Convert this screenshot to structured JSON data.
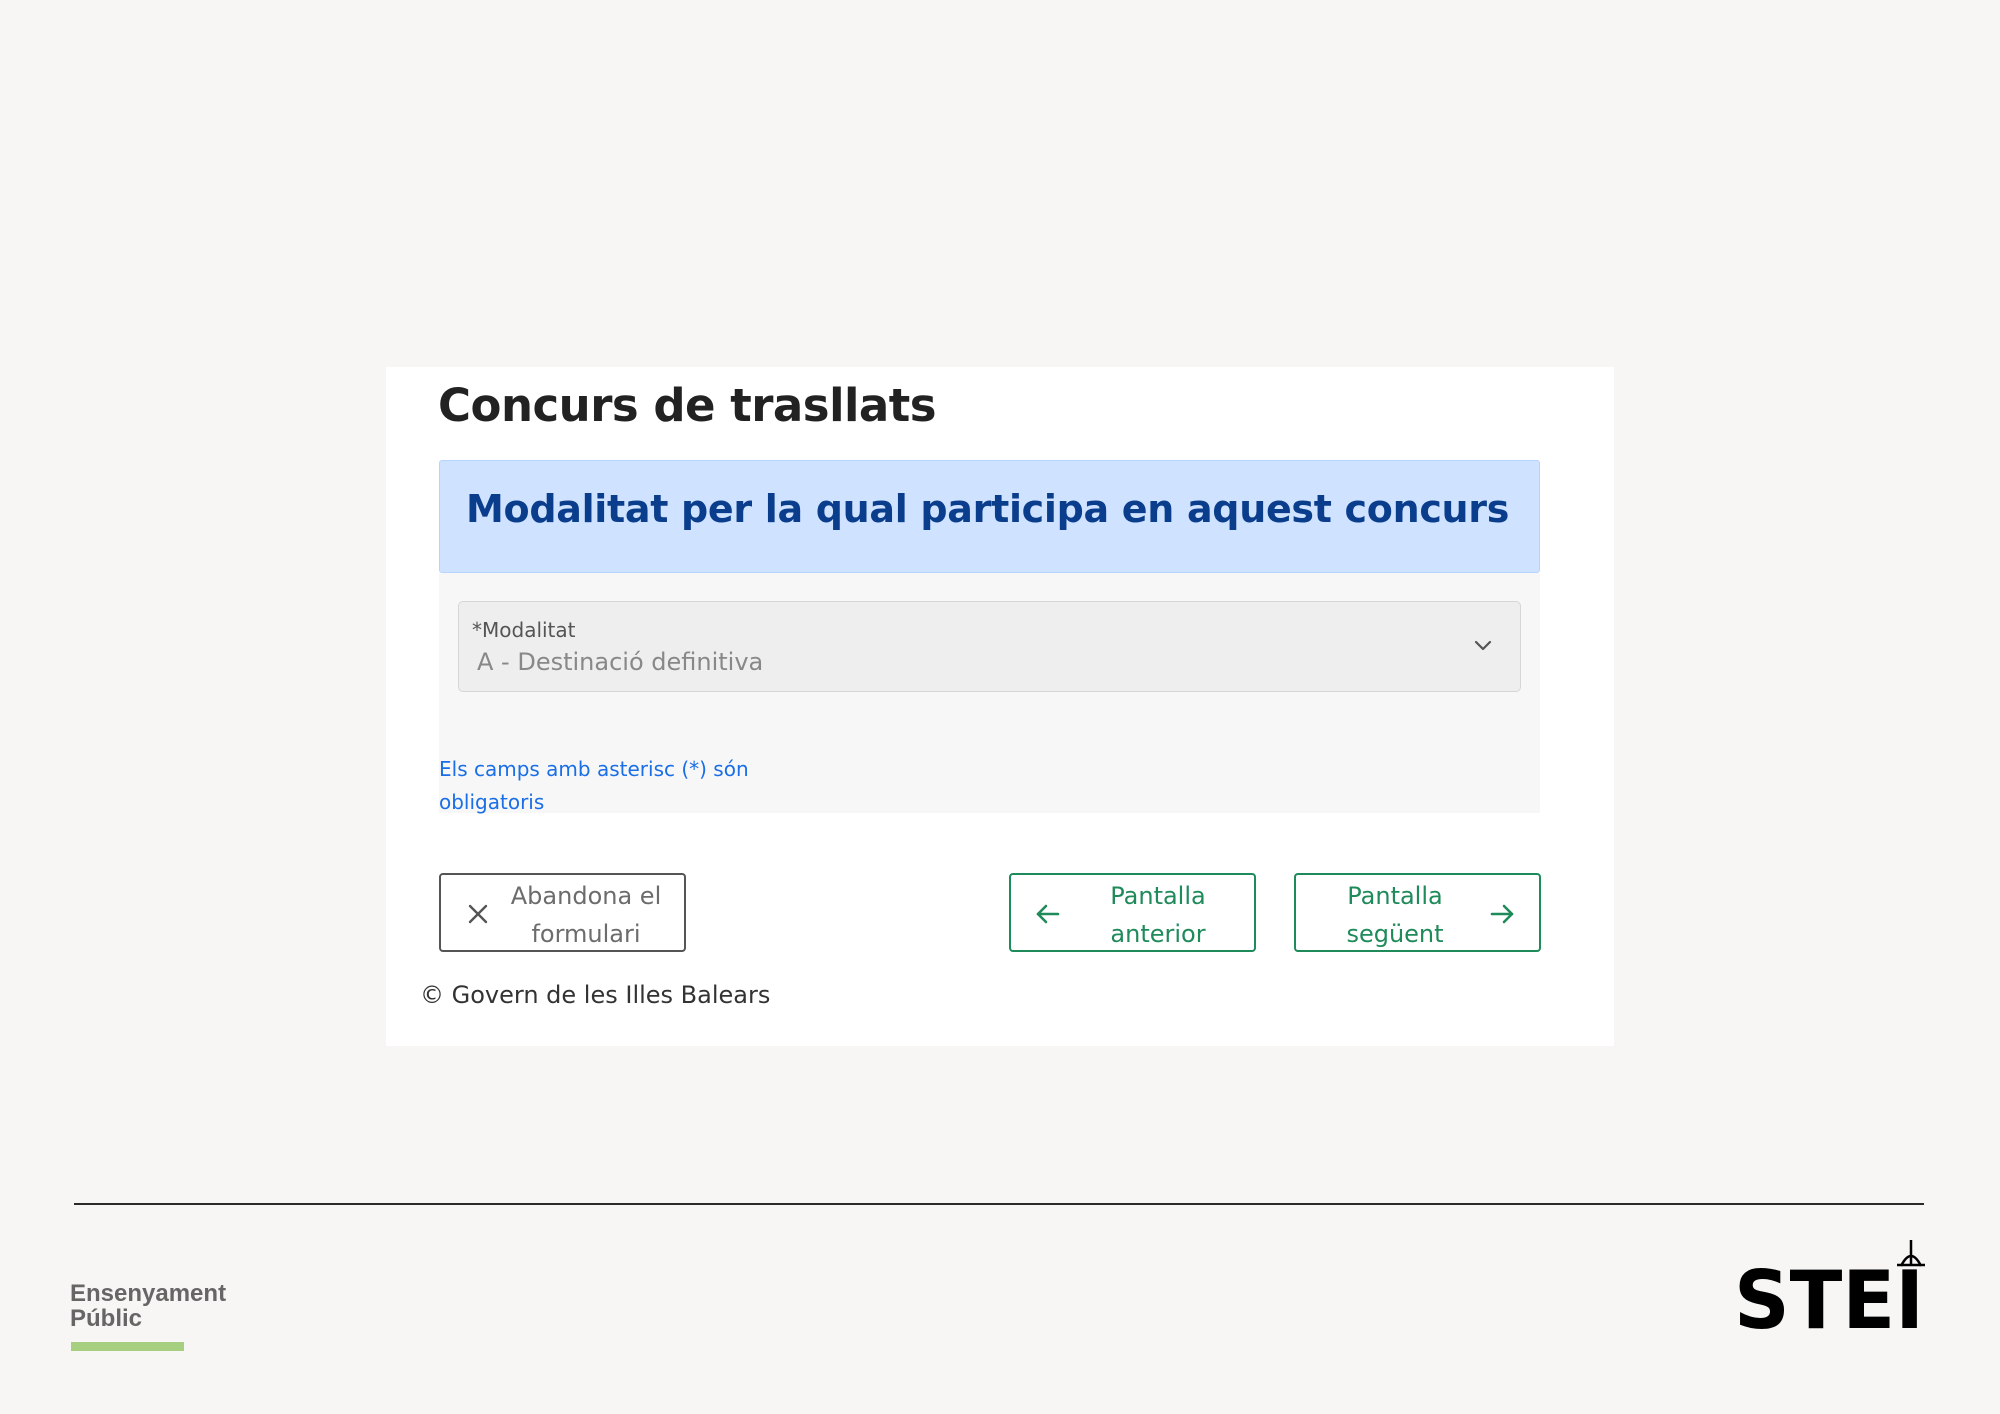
{
  "form": {
    "title": "Concurs de trasllats",
    "section_title": "Modalitat per la qual participa en aquest concurs",
    "select": {
      "label": "*Modalitat",
      "value": "A - Destinació definitiva"
    },
    "required_note": "Els camps amb asterisc (*) són obligatoris",
    "buttons": {
      "abandon": "Abandona el\nformulari",
      "previous": "Pantalla\nanterior",
      "next": "Pantalla\nsegüent"
    },
    "copyright": "© Govern de les Illes Balears"
  },
  "footer": {
    "brand_line1": "Ensenyament",
    "brand_line2": "Públic",
    "logo_text": "STEI"
  },
  "colors": {
    "page_background": "#f7f6f4",
    "section_header_bg": "#cfe2ff",
    "section_title": "#0a3d8c",
    "link_blue": "#1a6ee6",
    "button_green": "#1f8a5a",
    "brand_green": "#a6cf7f"
  }
}
